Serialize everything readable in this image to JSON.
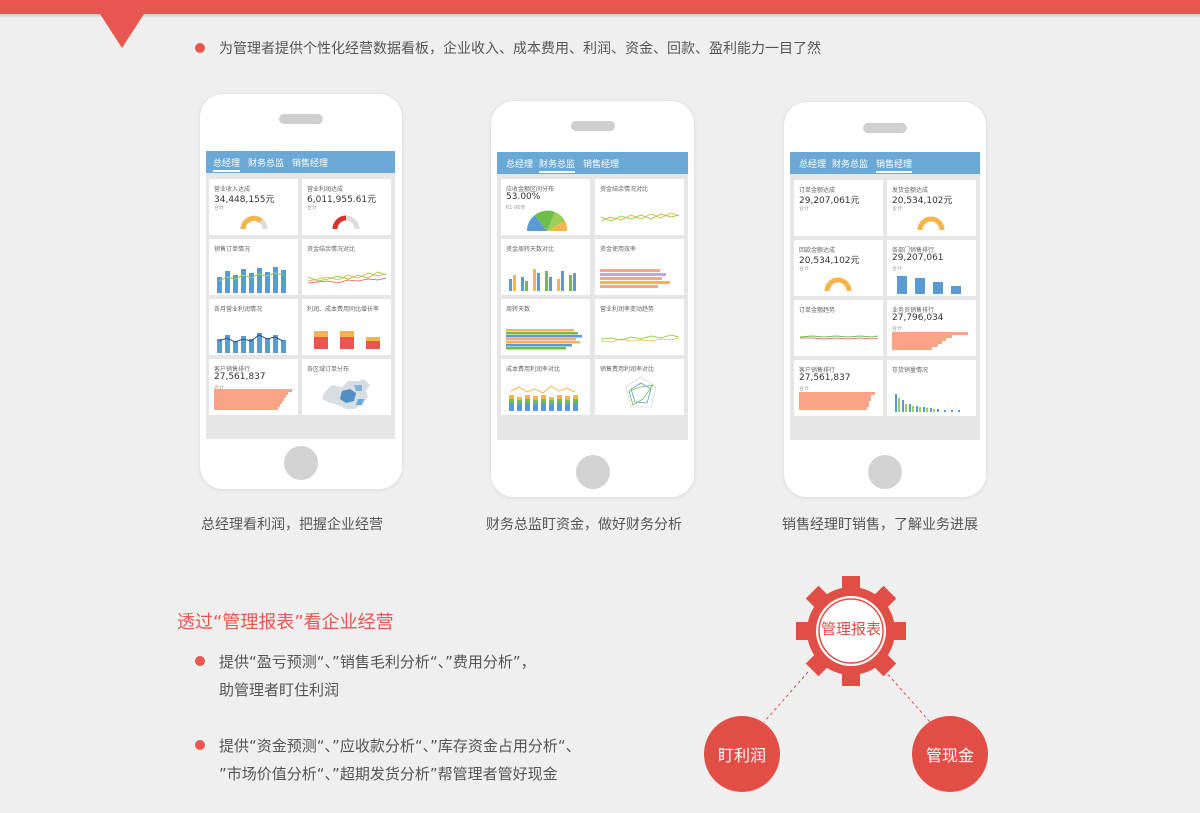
{
  "intro": "为管理者提供个性化经营数据看板，企业收入、成本费用、利润、资金、回款、盈利能力一目了然",
  "phones": [
    {
      "tabs": [
        "总经理",
        "财务总监",
        "销售经理"
      ],
      "active_tab": 0,
      "cards": [
        {
          "title": "营业收入达成",
          "value": "34,448,155元",
          "sub": "合计"
        },
        {
          "title": "营业利润达成",
          "value": "6,011,955.61元",
          "sub": "合计"
        },
        {
          "title": "销售订单情况"
        },
        {
          "title": "资金结余情况对比"
        },
        {
          "title": "各月营业利润情况"
        },
        {
          "title": "利润、成本费用同比增长率"
        },
        {
          "title": "客户销售排行",
          "value": "27,561,837",
          "sub": "合计"
        },
        {
          "title": "各区域订单分布"
        }
      ],
      "caption": "总经理看利润，把握企业经营"
    },
    {
      "tabs": [
        "总经理",
        "财务总监",
        "销售经理"
      ],
      "active_tab": 1,
      "cards": [
        {
          "title": "应收金额区间分布",
          "value": "53.00%",
          "sub": "61-90天"
        },
        {
          "title": "资金结余情况对比"
        },
        {
          "title": "资金周转天数对比"
        },
        {
          "title": "资金使用效率"
        },
        {
          "title": "周转天数"
        },
        {
          "title": "营业利润率变动趋势"
        },
        {
          "title": "成本费用利润率对比"
        },
        {
          "title": "销售费用利润率对比"
        }
      ],
      "caption": "财务总监盯资金，做好财务分析"
    },
    {
      "tabs": [
        "总经理",
        "财务总监",
        "销售经理"
      ],
      "active_tab": 2,
      "cards": [
        {
          "title": "订单金额达成",
          "value": "29,207,061元",
          "sub": "合计"
        },
        {
          "title": "发货金额达成",
          "value": "20,534,102元",
          "sub": "合计"
        },
        {
          "title": "回款金额达成",
          "value": "20,534,102元",
          "sub": "合计"
        },
        {
          "title": "各部门销售排行",
          "value": "29,207,061",
          "sub": "合计"
        },
        {
          "title": "订单金额趋势"
        },
        {
          "title": "业务员销售排行",
          "value": "27,796,034",
          "sub": "合计"
        },
        {
          "title": "客户销售排行",
          "value": "27,561,837",
          "sub": "合计"
        },
        {
          "title": "存货销量情况"
        }
      ],
      "caption": "销售经理盯销售，了解业务进展"
    }
  ],
  "section": {
    "title": "透过“管理报表”看企业经营",
    "bullets": [
      [
        "提供“盈亏预测“、”销售毛利分析“、”费用分析”，",
        "助管理者盯住利润"
      ],
      [
        "提供“资金预测“、”应收款分析“、”库存资金占用分析“、",
        "”市场价值分析“、”超期发货分析”帮管理者管好现金"
      ]
    ]
  },
  "diagram": {
    "gear_label": "管理报表",
    "left_label": "盯利润",
    "right_label": "管现金",
    "colors": {
      "accent": "#e14e46",
      "tab_bar": "#6aa8d6"
    }
  }
}
